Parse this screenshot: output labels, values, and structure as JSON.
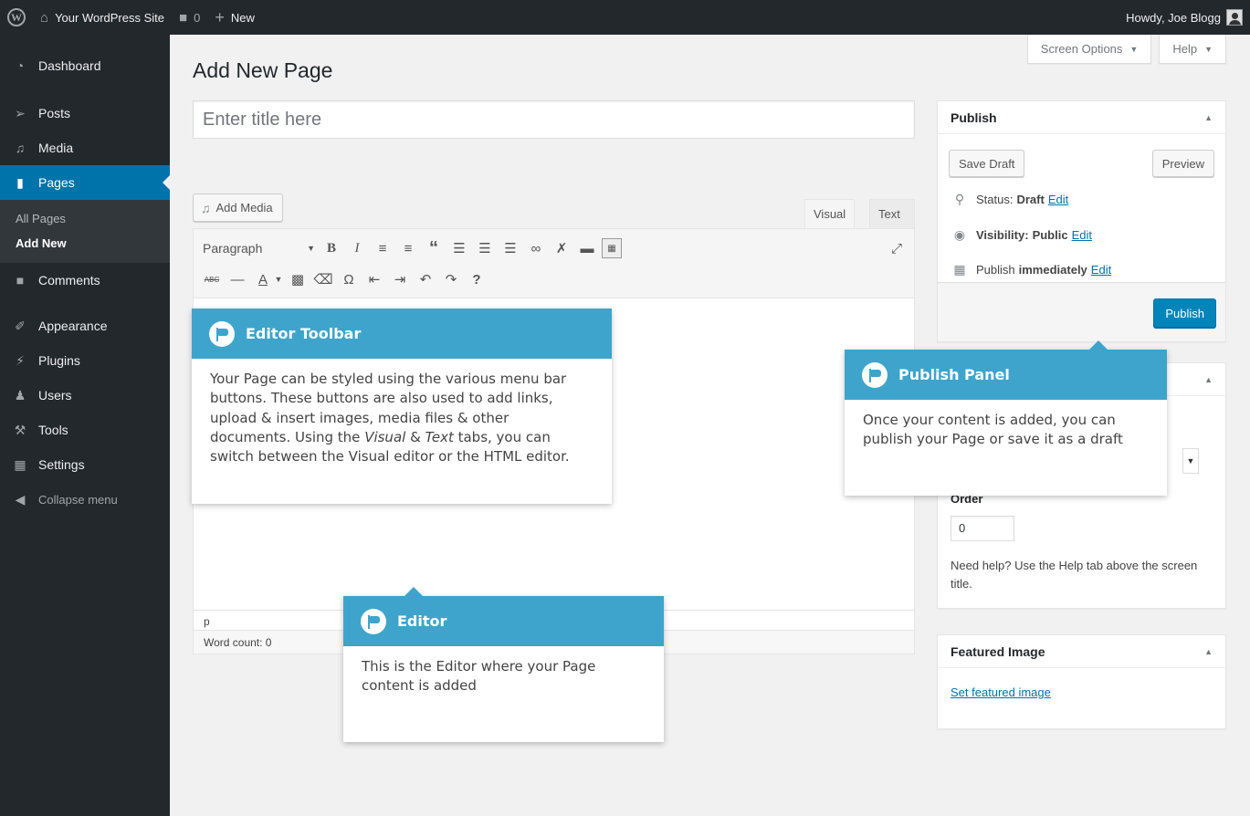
{
  "admin_bar": {
    "site_name": "Your WordPress Site",
    "comments_count": "0",
    "new_label": "New",
    "howdy": "Howdy, Joe Blogg"
  },
  "sidebar": {
    "items": [
      {
        "label": "Dashboard",
        "icon": "dashboard-icon"
      },
      {
        "label": "Posts",
        "icon": "pin-icon"
      },
      {
        "label": "Media",
        "icon": "media-icon"
      },
      {
        "label": "Pages",
        "icon": "pages-icon"
      },
      {
        "label": "Comments",
        "icon": "comment-icon"
      },
      {
        "label": "Appearance",
        "icon": "brush-icon"
      },
      {
        "label": "Plugins",
        "icon": "plugin-icon"
      },
      {
        "label": "Users",
        "icon": "users-icon"
      },
      {
        "label": "Tools",
        "icon": "wrench-icon"
      },
      {
        "label": "Settings",
        "icon": "settings-icon"
      }
    ],
    "submenu": [
      "All Pages",
      "Add New"
    ],
    "collapse_label": "Collapse menu"
  },
  "screen_tabs": {
    "screen_options": "Screen Options",
    "help": "Help"
  },
  "page": {
    "title": "Add New Page",
    "title_placeholder": "Enter title here"
  },
  "editor": {
    "add_media": "Add Media",
    "tab_visual": "Visual",
    "tab_text": "Text",
    "format_select": "Paragraph",
    "path": "p",
    "word_count": "Word count: 0"
  },
  "publish": {
    "heading": "Publish",
    "save_draft": "Save Draft",
    "preview": "Preview",
    "status_label": "Status:",
    "status_value": "Draft",
    "visibility_label": "Visibility:",
    "visibility_value": "Public",
    "publish_label": "Publish",
    "publish_value": "immediately",
    "edit": "Edit",
    "publish_button": "Publish"
  },
  "attributes": {
    "order_label": "Order",
    "order_value": "0",
    "help_text": "Need help? Use the Help tab above the screen title."
  },
  "featured_image": {
    "heading": "Featured Image",
    "link": "Set featured image"
  },
  "callouts": {
    "toolbar": {
      "title": "Editor Toolbar",
      "body_1": "Your Page can be styled using the various menu bar buttons. These buttons are also used to add links, upload & insert images, media files & other documents. Using the ",
      "body_visual": "Visual",
      "body_amp": " & ",
      "body_text": "Text",
      "body_2": " tabs, you can switch between the Visual editor or the HTML editor."
    },
    "publish": {
      "title": "Publish Panel",
      "body": "Once your content is added, you can publish your Page or save it as a draft"
    },
    "editor": {
      "title": "Editor",
      "body": "This is the Editor where your Page content is added"
    }
  },
  "colors": {
    "admin_dark": "#23282d",
    "accent_blue": "#0073aa",
    "callout_blue": "#3ea4cc",
    "background": "#f1f1f1"
  }
}
